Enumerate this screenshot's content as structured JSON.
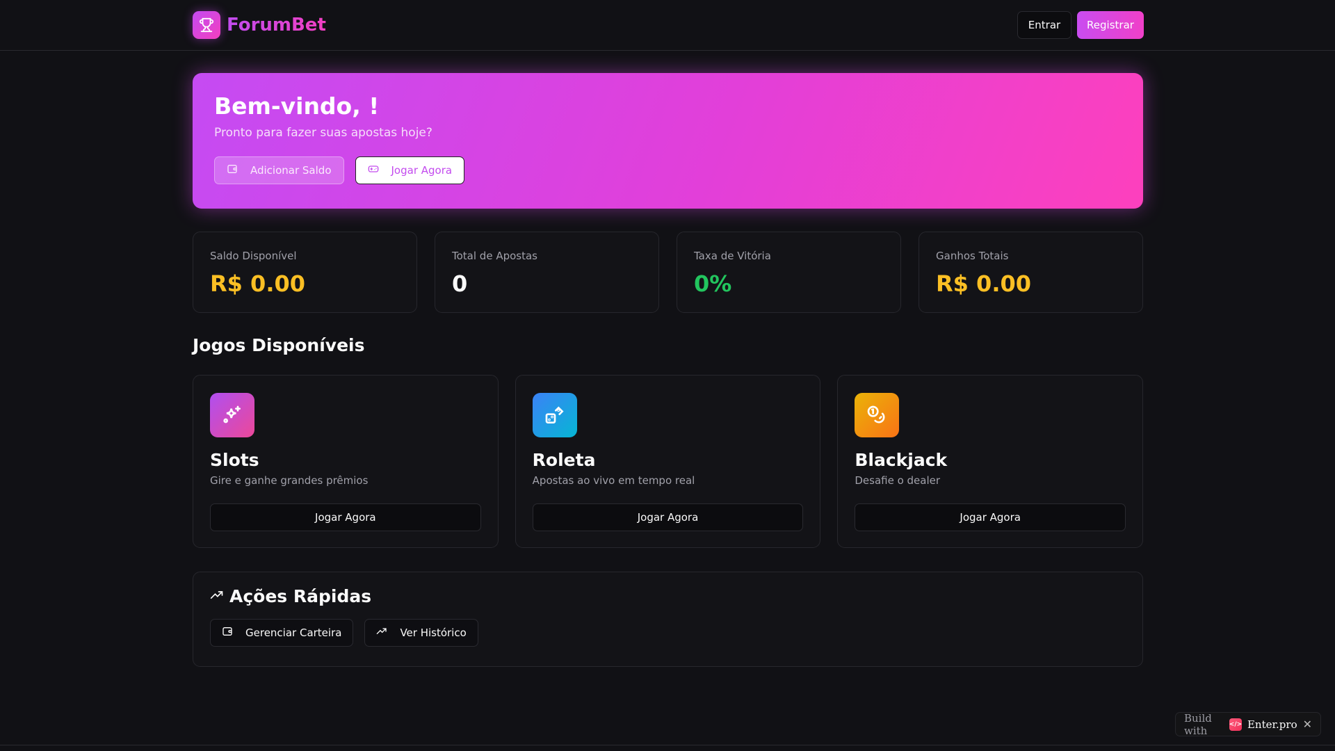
{
  "header": {
    "brand": "ForumBet",
    "login": "Entrar",
    "register": "Registrar"
  },
  "hero": {
    "title": "Bem-vindo, !",
    "subtitle": "Pronto para fazer suas apostas hoje?",
    "add_balance": "Adicionar Saldo",
    "play_now": "Jogar Agora"
  },
  "stats": [
    {
      "label": "Saldo Disponível",
      "value": "R$ 0.00",
      "color": "#fbbf24"
    },
    {
      "label": "Total de Apostas",
      "value": "0",
      "color": "#fafafa"
    },
    {
      "label": "Taxa de Vitória",
      "value": "0%",
      "color": "#22c55e"
    },
    {
      "label": "Ganhos Totais",
      "value": "R$ 0.00",
      "color": "#fbbf24"
    }
  ],
  "games_section": {
    "title": "Jogos Disponíveis"
  },
  "games": [
    {
      "name": "Slots",
      "description": "Gire e ganhe grandes prêmios",
      "button": "Jogar Agora",
      "icon": "sparkles-icon"
    },
    {
      "name": "Roleta",
      "description": "Apostas ao vivo em tempo real",
      "button": "Jogar Agora",
      "icon": "dice-icon"
    },
    {
      "name": "Blackjack",
      "description": "Desafie o dealer",
      "button": "Jogar Agora",
      "icon": "coins-icon"
    }
  ],
  "quick_actions": {
    "title": "Ações Rápidas",
    "manage_wallet": "Gerenciar Carteira",
    "view_history": "Ver Histórico"
  },
  "badge": {
    "prefix": "Build with",
    "name": "Enter.pro",
    "logo": "</>"
  }
}
